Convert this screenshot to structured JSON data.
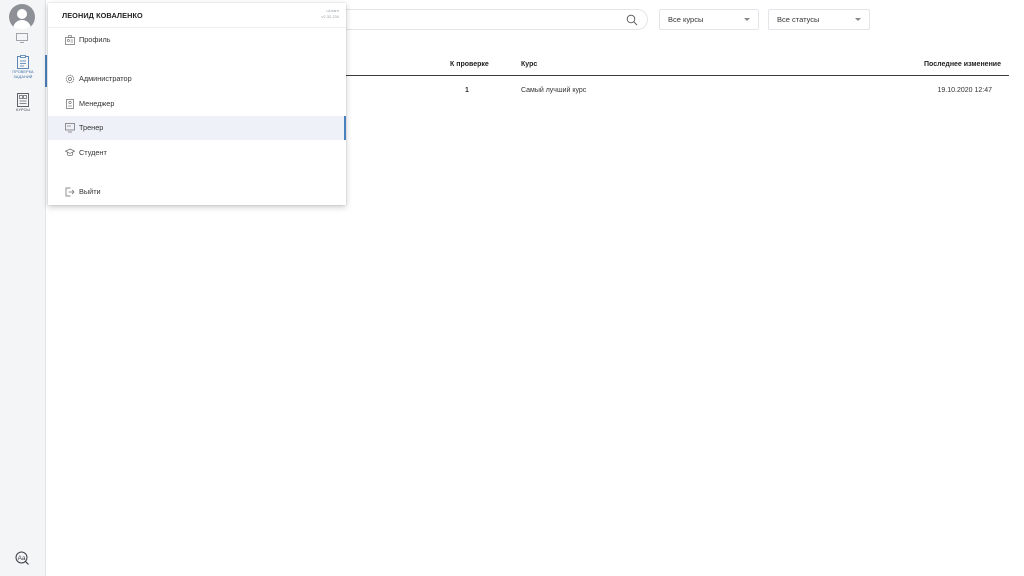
{
  "rail": {
    "items": [
      {
        "name": "review",
        "caption_line1": "ПРОВЕРКА",
        "caption_line2": "ЗАДАНИЙ",
        "active": true
      },
      {
        "name": "courses",
        "caption_line1": "КУРСЫ",
        "active": false
      }
    ],
    "accent": "#4a80bd"
  },
  "search": {
    "placeholder": ""
  },
  "filters": {
    "courses": {
      "selected": "Все курсы"
    },
    "statuses": {
      "selected": "Все статусы"
    }
  },
  "table": {
    "columns": {
      "to_review": "К проверке",
      "course": "Курс",
      "last_change": "Последнее изменение"
    },
    "rows": [
      {
        "to_review": "1",
        "course": "Самый лучший курс",
        "last_change": "19.10.2020 12:47"
      }
    ]
  },
  "menu": {
    "user_name": "ЛЕОНИД КОВАЛЕНКО",
    "app_name": "uLearn",
    "app_version": "v2.32.234",
    "items": [
      {
        "label": "Профиль",
        "icon": "profile-icon"
      },
      {
        "label": "Администратор",
        "icon": "gear-icon"
      },
      {
        "label": "Менеджер",
        "icon": "manager-icon"
      },
      {
        "label": "Тренер",
        "icon": "trainer-icon",
        "selected": true
      },
      {
        "label": "Студент",
        "icon": "student-icon"
      },
      {
        "label": "Выйти",
        "icon": "logout-icon"
      }
    ]
  }
}
